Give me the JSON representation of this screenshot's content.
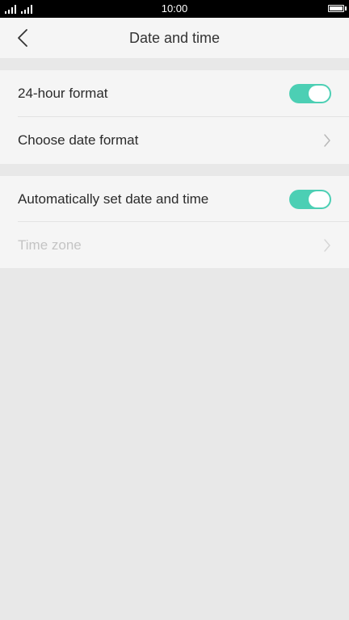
{
  "status_bar": {
    "time": "10:00"
  },
  "header": {
    "title": "Date and time",
    "back_icon": "chevron-left-icon"
  },
  "settings": {
    "group1": [
      {
        "label": "24-hour format",
        "control": "toggle",
        "on": true
      },
      {
        "label": "Choose date format",
        "control": "chevron"
      }
    ],
    "group2": [
      {
        "label": "Automatically set date and time",
        "control": "toggle",
        "on": true
      },
      {
        "label": "Time zone",
        "control": "chevron",
        "disabled": true
      }
    ]
  },
  "colors": {
    "accent": "#4ccfb4",
    "background": "#e8e8e8",
    "row_background": "#f5f5f5",
    "disabled_text": "#c4c4c4"
  }
}
